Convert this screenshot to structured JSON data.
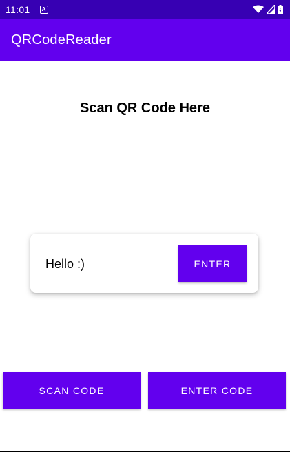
{
  "status_bar": {
    "time": "11:01",
    "notification_icon": "A",
    "icons": [
      "wifi-icon",
      "signal-icon",
      "battery-icon"
    ]
  },
  "app_bar": {
    "title": "QRCodeReader"
  },
  "main": {
    "heading": "Scan QR Code Here",
    "card": {
      "message": "Hello :)",
      "enter_label": "ENTER"
    },
    "buttons": {
      "scan_label": "SCAN CODE",
      "enter_code_label": "ENTER CODE"
    }
  },
  "colors": {
    "status_bar": "#3700b3",
    "primary": "#6200ee",
    "on_primary": "#ffffff"
  }
}
